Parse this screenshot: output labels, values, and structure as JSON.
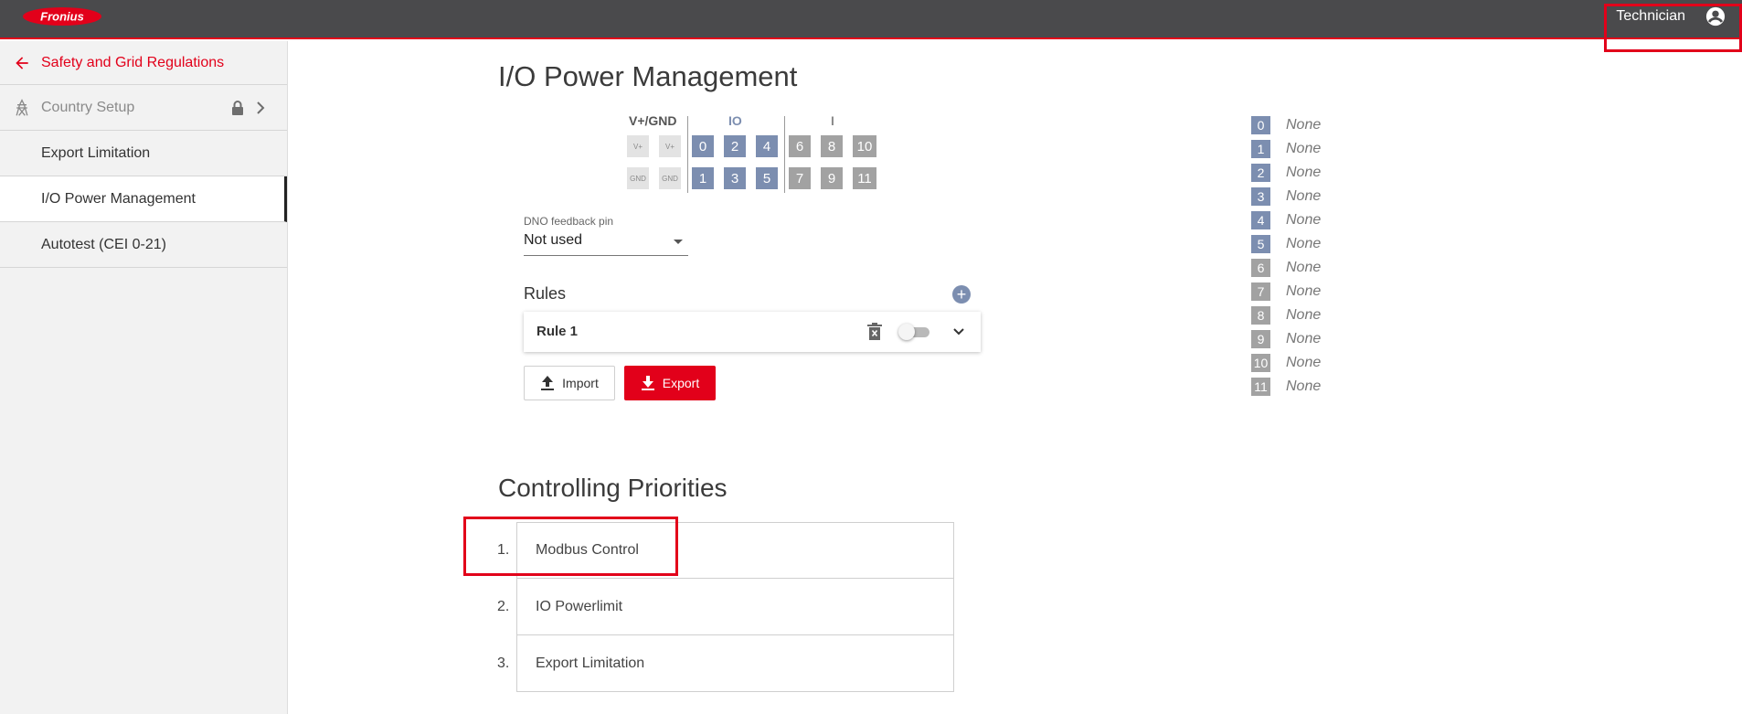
{
  "header": {
    "logo": "Fronius",
    "user_label": "Technician"
  },
  "sidebar": {
    "back_label": "Safety and Grid Regulations",
    "items": [
      {
        "label": "Country Setup",
        "locked": true
      },
      {
        "label": "Export Limitation"
      },
      {
        "label": "I/O Power Management",
        "active": true
      },
      {
        "label": "Autotest (CEI 0-21)"
      }
    ]
  },
  "main": {
    "title": "I/O Power Management",
    "pins": {
      "headers": {
        "power": "V+/GND",
        "io": "IO",
        "input": "I"
      },
      "power_top": [
        "V+",
        "V+"
      ],
      "power_bottom": [
        "GND",
        "GND"
      ],
      "io_top": [
        "0",
        "2",
        "4"
      ],
      "io_bottom": [
        "1",
        "3",
        "5"
      ],
      "input_top": [
        "6",
        "8",
        "10"
      ],
      "input_bottom": [
        "7",
        "9",
        "11"
      ]
    },
    "dno": {
      "label": "DNO feedback pin",
      "value": "Not used"
    },
    "rules": {
      "title": "Rules",
      "items": [
        {
          "name": "Rule 1",
          "enabled": false
        }
      ]
    },
    "buttons": {
      "import": "Import",
      "export": "Export"
    },
    "pin_legend": [
      {
        "pin": "0",
        "value": "None"
      },
      {
        "pin": "1",
        "value": "None"
      },
      {
        "pin": "2",
        "value": "None"
      },
      {
        "pin": "3",
        "value": "None"
      },
      {
        "pin": "4",
        "value": "None"
      },
      {
        "pin": "5",
        "value": "None"
      },
      {
        "pin": "6",
        "value": "None"
      },
      {
        "pin": "7",
        "value": "None"
      },
      {
        "pin": "8",
        "value": "None"
      },
      {
        "pin": "9",
        "value": "None"
      },
      {
        "pin": "10",
        "value": "None"
      },
      {
        "pin": "11",
        "value": "None"
      }
    ],
    "priorities": {
      "title": "Controlling Priorities",
      "items": [
        {
          "num": "1.",
          "label": "Modbus Control"
        },
        {
          "num": "2.",
          "label": "IO Powerlimit"
        },
        {
          "num": "3.",
          "label": "Export Limitation"
        }
      ]
    }
  },
  "colors": {
    "brand_red": "#e2001a",
    "topbar": "#4a4a4c",
    "io_pin": "#7c8eb0",
    "input_pin": "#a2a2a2"
  }
}
